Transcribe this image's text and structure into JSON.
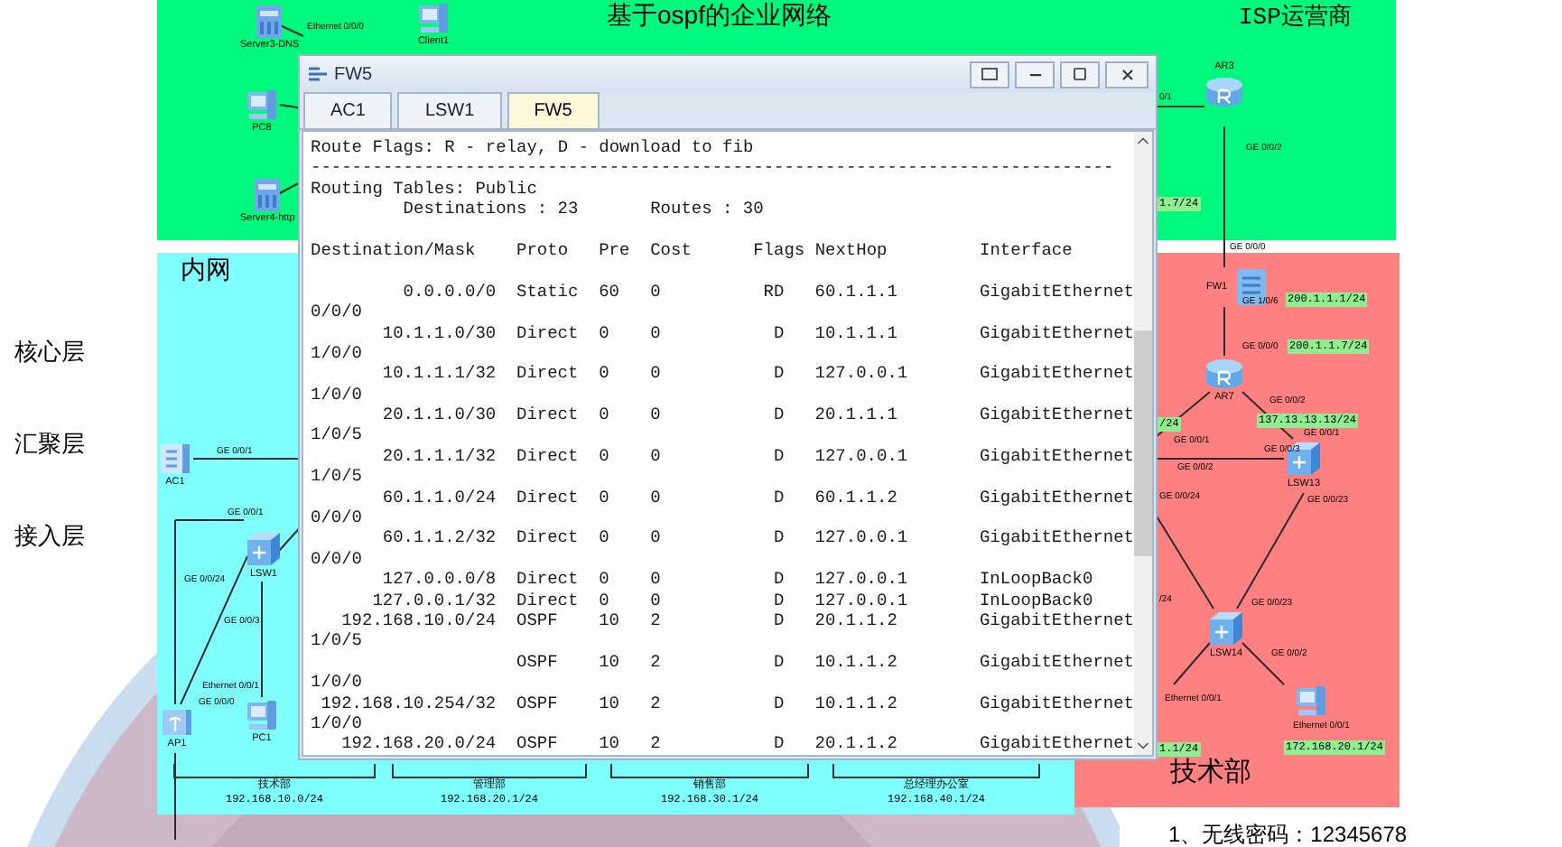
{
  "side_labels": [
    "核心层",
    "汇聚层",
    "接入层"
  ],
  "topology": {
    "title": "基于ospf的企业网络",
    "zones": [
      {
        "label": "ISP运营商",
        "color": "#00f87c"
      },
      {
        "label": "内网",
        "color": "#80ffff"
      },
      {
        "label": "技术部",
        "color": "#ff8080"
      }
    ],
    "devices": [
      {
        "kind": "server",
        "label": "Server3-DNS"
      },
      {
        "kind": "pc",
        "label": "Client1"
      },
      {
        "kind": "pc",
        "label": "PC8"
      },
      {
        "kind": "server",
        "label": "Server4-http"
      },
      {
        "kind": "router",
        "label": "AR3"
      },
      {
        "kind": "firewall",
        "label": "FW1"
      },
      {
        "kind": "router",
        "label": "AR7"
      },
      {
        "kind": "switch",
        "label": "LSW13"
      },
      {
        "kind": "switch",
        "label": "LSW14"
      },
      {
        "kind": "pc"
      },
      {
        "kind": "ac",
        "label": "AC1"
      },
      {
        "kind": "switch",
        "label": "LSW1"
      },
      {
        "kind": "ap",
        "label": "AP1"
      },
      {
        "kind": "pc",
        "label": "PC1"
      }
    ],
    "port_labels": [
      "Ethernet 0/0/0",
      "0/1",
      "GE 0/0/2",
      "GE 0/0/0",
      "GE 1/0/6",
      "GE 0/0/0",
      "GE 0/0/2",
      "GE 0/0/1",
      "GE 0/0/1",
      "GE 0/0/2",
      "GE 0/0/3",
      "GE 0/0/24",
      "GE 0/0/23",
      "/24",
      "GE 0/0/23",
      "GE 0/0/2",
      "Ethernet 0/0/1",
      "Ethernet 0/0/1",
      "GE 0/0/1",
      "GE 0/0/1",
      "GE 0/0/24",
      "GE 0/0/3",
      "Ethernet 0/0/1",
      "GE 0/0/0"
    ],
    "ip_tags": [
      "1.7/24",
      "200.1.1.1/24",
      "200.1.1.7/24",
      "137.13.13.13/24",
      "/24",
      "1.1/24",
      "172.168.20.1/24"
    ],
    "departments": [
      {
        "name": "技术部",
        "subnet": "192.168.10.0/24"
      },
      {
        "name": "管理部",
        "subnet": "192.168.20.1/24"
      },
      {
        "name": "销售部",
        "subnet": "192.168.30.1/24"
      },
      {
        "name": "总经理办公室",
        "subnet": "192.168.40.1/24"
      }
    ],
    "note": "1、无线密码：12345678"
  },
  "window": {
    "title": "FW5",
    "tabs": [
      {
        "label": "AC1",
        "selected": false
      },
      {
        "label": "LSW1",
        "selected": false
      },
      {
        "label": "FW5",
        "selected": true
      }
    ],
    "terminal": {
      "flags_line": "Route Flags: R - relay, D - download to fib",
      "rule": "------------------------------------------------------------------------------",
      "table_title": "Routing Tables: Public",
      "destinations": "Destinations : 23",
      "routes": "Routes : 30",
      "columns": [
        "Destination/Mask",
        "Proto",
        "Pre",
        "Cost",
        "Flags",
        "NextHop",
        "Interface"
      ],
      "rows": [
        {
          "dest": "0.0.0.0/0",
          "proto": "Static",
          "pre": "60",
          "cost": "0",
          "flags": "RD",
          "nexthop": "60.1.1.1",
          "iface": "GigabitEthernet",
          "iface_cont": "0/0/0"
        },
        {
          "dest": "10.1.1.0/30",
          "proto": "Direct",
          "pre": "0",
          "cost": "0",
          "flags": "D",
          "nexthop": "10.1.1.1",
          "iface": "GigabitEthernet",
          "iface_cont": "1/0/0"
        },
        {
          "dest": "10.1.1.1/32",
          "proto": "Direct",
          "pre": "0",
          "cost": "0",
          "flags": "D",
          "nexthop": "127.0.0.1",
          "iface": "GigabitEthernet",
          "iface_cont": "1/0/0"
        },
        {
          "dest": "20.1.1.0/30",
          "proto": "Direct",
          "pre": "0",
          "cost": "0",
          "flags": "D",
          "nexthop": "20.1.1.1",
          "iface": "GigabitEthernet",
          "iface_cont": "1/0/5"
        },
        {
          "dest": "20.1.1.1/32",
          "proto": "Direct",
          "pre": "0",
          "cost": "0",
          "flags": "D",
          "nexthop": "127.0.0.1",
          "iface": "GigabitEthernet",
          "iface_cont": "1/0/5"
        },
        {
          "dest": "60.1.1.0/24",
          "proto": "Direct",
          "pre": "0",
          "cost": "0",
          "flags": "D",
          "nexthop": "60.1.1.2",
          "iface": "GigabitEthernet",
          "iface_cont": "0/0/0"
        },
        {
          "dest": "60.1.1.2/32",
          "proto": "Direct",
          "pre": "0",
          "cost": "0",
          "flags": "D",
          "nexthop": "127.0.0.1",
          "iface": "GigabitEthernet",
          "iface_cont": "0/0/0"
        },
        {
          "dest": "127.0.0.0/8",
          "proto": "Direct",
          "pre": "0",
          "cost": "0",
          "flags": "D",
          "nexthop": "127.0.0.1",
          "iface": "InLoopBack0"
        },
        {
          "dest": "127.0.0.1/32",
          "proto": "Direct",
          "pre": "0",
          "cost": "0",
          "flags": "D",
          "nexthop": "127.0.0.1",
          "iface": "InLoopBack0"
        },
        {
          "dest": "192.168.10.0/24",
          "proto": "OSPF",
          "pre": "10",
          "cost": "2",
          "flags": "D",
          "nexthop": "20.1.1.2",
          "iface": "GigabitEthernet",
          "iface_cont": "1/0/5"
        },
        {
          "proto": "OSPF",
          "pre": "10",
          "cost": "2",
          "flags": "D",
          "nexthop": "10.1.1.2",
          "iface": "GigabitEthernet",
          "iface_cont": "1/0/0"
        },
        {
          "dest": "192.168.10.254/32",
          "proto": "OSPF",
          "pre": "10",
          "cost": "2",
          "flags": "D",
          "nexthop": "10.1.1.2",
          "iface": "GigabitEthernet",
          "iface_cont": "1/0/0"
        },
        {
          "dest": "192.168.20.0/24",
          "proto": "OSPF",
          "pre": "10",
          "cost": "2",
          "flags": "D",
          "nexthop": "20.1.1.2",
          "iface": "GigabitEthernet"
        }
      ]
    }
  }
}
